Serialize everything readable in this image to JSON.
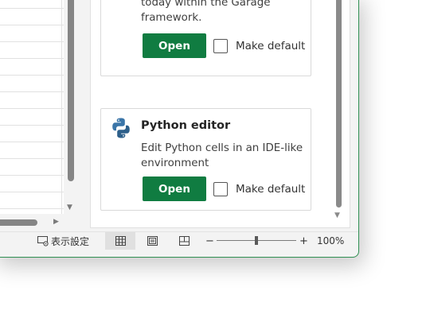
{
  "pane": {
    "cards": [
      {
        "description_lines": [
          "today within the Garage",
          "framework."
        ],
        "open_label": "Open",
        "make_default_label": "Make default",
        "make_default_checked": false
      },
      {
        "title": "Python editor",
        "icon": "python-icon",
        "description_lines": [
          "Edit Python cells in an IDE-like",
          "environment"
        ],
        "open_label": "Open",
        "make_default_label": "Make default",
        "make_default_checked": false
      }
    ]
  },
  "statusbar": {
    "display_settings_label": "表示設定",
    "zoom_minus": "−",
    "zoom_plus": "+",
    "zoom_level": "100%",
    "zoom_percent": 100
  },
  "colors": {
    "accent": "#107c41",
    "window_border": "#2f8f52",
    "python_blue": "#3a75a8",
    "python_dark": "#2d5f8a"
  }
}
